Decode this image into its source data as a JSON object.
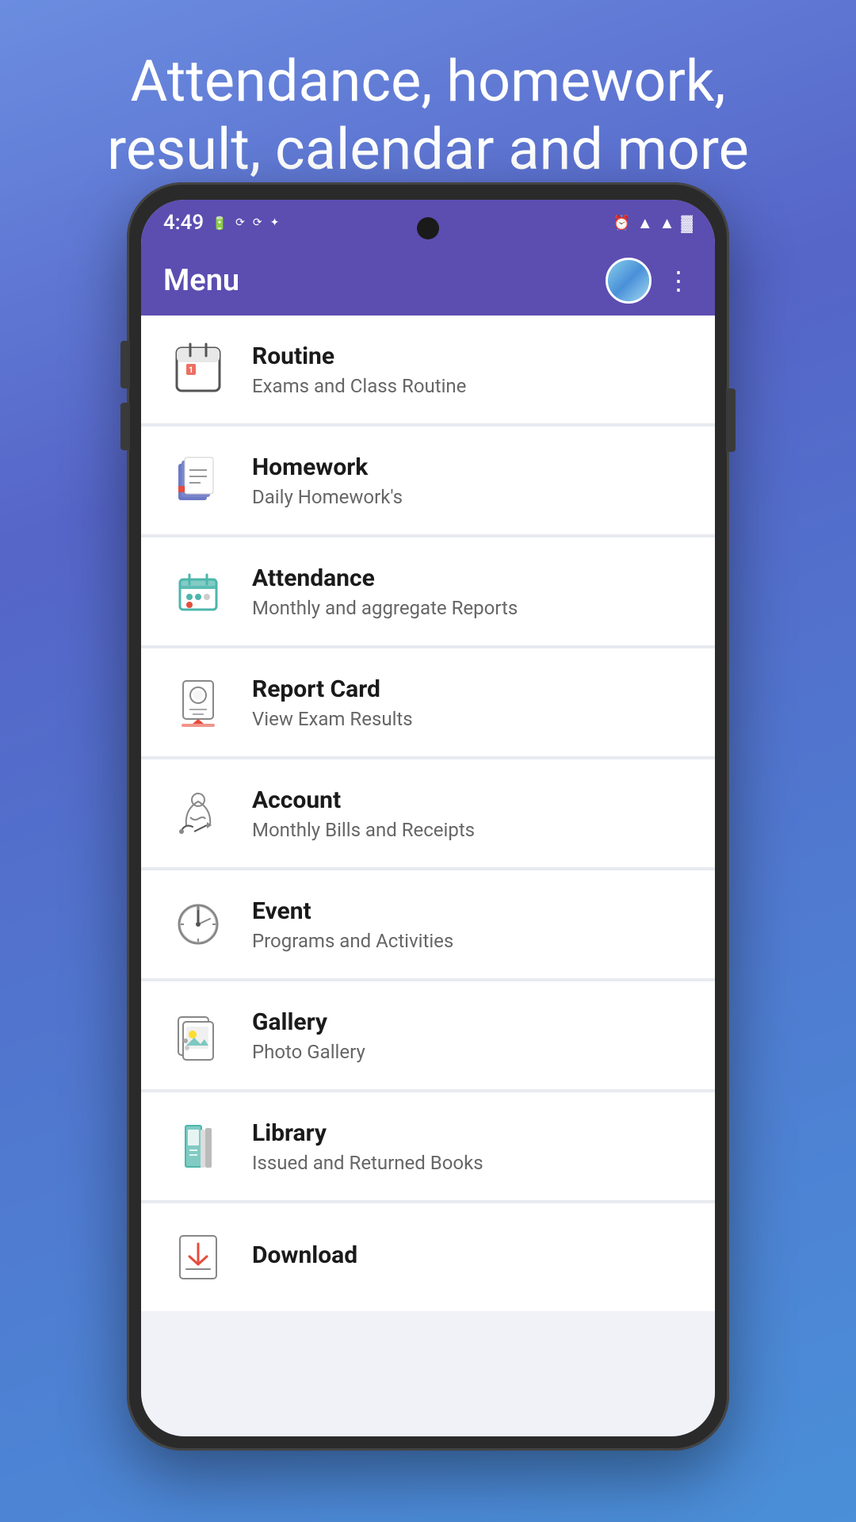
{
  "page": {
    "background_color": "#5b7fd4",
    "headline": "Attendance, homework,\nresult, calendar and more"
  },
  "status_bar": {
    "time": "4:49",
    "icons": [
      "🔋",
      "📶",
      "📡"
    ]
  },
  "app_bar": {
    "title": "Menu",
    "more_button_label": "⋮"
  },
  "menu_items": [
    {
      "id": "routine",
      "title": "Routine",
      "subtitle": "Exams and Class Routine",
      "icon": "routine"
    },
    {
      "id": "homework",
      "title": "Homework",
      "subtitle": "Daily Homework's",
      "icon": "homework"
    },
    {
      "id": "attendance",
      "title": "Attendance",
      "subtitle": "Monthly and aggregate Reports",
      "icon": "attendance"
    },
    {
      "id": "report-card",
      "title": "Report Card",
      "subtitle": "View Exam Results",
      "icon": "report-card"
    },
    {
      "id": "account",
      "title": "Account",
      "subtitle": "Monthly Bills and Receipts",
      "icon": "account"
    },
    {
      "id": "event",
      "title": "Event",
      "subtitle": "Programs and Activities",
      "icon": "event"
    },
    {
      "id": "gallery",
      "title": "Gallery",
      "subtitle": "Photo Gallery",
      "icon": "gallery"
    },
    {
      "id": "library",
      "title": "Library",
      "subtitle": "Issued and Returned Books",
      "icon": "library"
    },
    {
      "id": "download",
      "title": "Download",
      "subtitle": "",
      "icon": "download"
    }
  ],
  "download_button": {
    "label": "Download"
  }
}
